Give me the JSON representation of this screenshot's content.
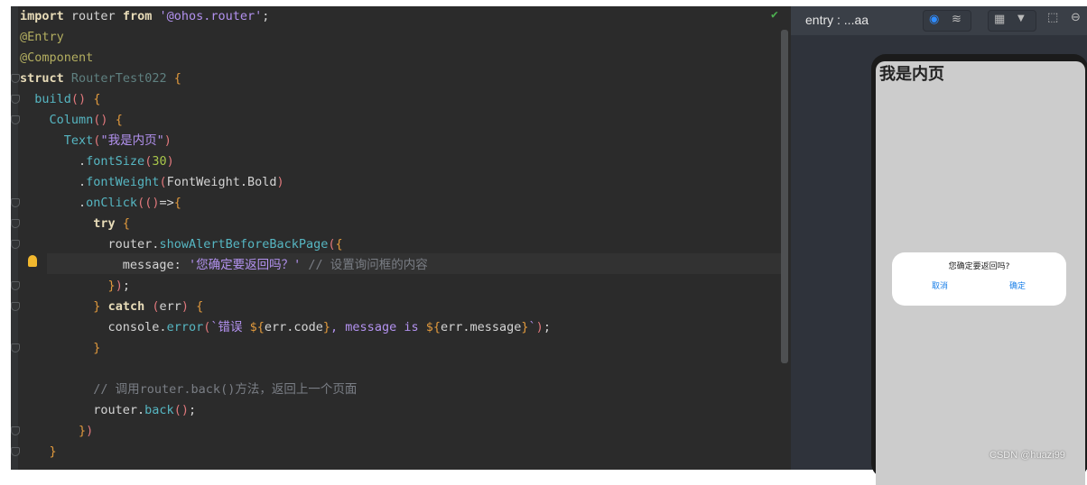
{
  "editor": {
    "lines": [
      [
        [
          "import",
          "kw"
        ],
        [
          " router ",
          "pl"
        ],
        [
          "from",
          "kw"
        ],
        [
          " ",
          "pl"
        ],
        [
          "'@ohos.router'",
          "str"
        ],
        [
          ";",
          "pl"
        ]
      ],
      [
        [
          "@Entry",
          "dec"
        ]
      ],
      [
        [
          "@Component",
          "dec"
        ]
      ],
      [
        [
          "struct",
          "kw"
        ],
        [
          " ",
          "pl"
        ],
        [
          "RouterTest022",
          "cls"
        ],
        [
          " ",
          "pl"
        ],
        [
          "{",
          "br"
        ]
      ],
      [
        [
          "  ",
          "pl"
        ],
        [
          "build",
          "fn"
        ],
        [
          "()",
          "par"
        ],
        [
          " ",
          "pl"
        ],
        [
          "{",
          "br"
        ]
      ],
      [
        [
          "    ",
          "pl"
        ],
        [
          "Column",
          "fn"
        ],
        [
          "()",
          "par"
        ],
        [
          " ",
          "pl"
        ],
        [
          "{",
          "br"
        ]
      ],
      [
        [
          "      ",
          "pl"
        ],
        [
          "Text",
          "fn"
        ],
        [
          "(",
          "par"
        ],
        [
          "\"我是内页\"",
          "str"
        ],
        [
          ")",
          "par"
        ]
      ],
      [
        [
          "        .",
          "pl"
        ],
        [
          "fontSize",
          "fn"
        ],
        [
          "(",
          "par"
        ],
        [
          "30",
          "num"
        ],
        [
          ")",
          "par"
        ]
      ],
      [
        [
          "        .",
          "pl"
        ],
        [
          "fontWeight",
          "fn"
        ],
        [
          "(",
          "par"
        ],
        [
          "FontWeight.Bold",
          "pl"
        ],
        [
          ")",
          "par"
        ]
      ],
      [
        [
          "        .",
          "pl"
        ],
        [
          "onClick",
          "fn"
        ],
        [
          "(()",
          "par"
        ],
        [
          "=>",
          "pl"
        ],
        [
          "{",
          "br"
        ]
      ],
      [
        [
          "          ",
          "pl"
        ],
        [
          "try",
          "kw"
        ],
        [
          " ",
          "pl"
        ],
        [
          "{",
          "br"
        ]
      ],
      [
        [
          "            router.",
          "pl"
        ],
        [
          "showAlertBeforeBackPage",
          "fn"
        ],
        [
          "(",
          "par"
        ],
        [
          "{",
          "br"
        ]
      ],
      [
        [
          "              message: ",
          "pl"
        ],
        [
          "'您确定要返回吗？'",
          "str"
        ],
        [
          " // 设置询问框的内容",
          "cm"
        ]
      ],
      [
        [
          "            ",
          "pl"
        ],
        [
          "}",
          "br"
        ],
        [
          ")",
          "par"
        ],
        [
          ";",
          "pl"
        ]
      ],
      [
        [
          "          ",
          "pl"
        ],
        [
          "}",
          "br"
        ],
        [
          " ",
          "pl"
        ],
        [
          "catch",
          "kw"
        ],
        [
          " ",
          "pl"
        ],
        [
          "(",
          "par"
        ],
        [
          "err",
          "pl"
        ],
        [
          ")",
          "par"
        ],
        [
          " ",
          "pl"
        ],
        [
          "{",
          "br"
        ]
      ],
      [
        [
          "            console.",
          "pl"
        ],
        [
          "error",
          "fn"
        ],
        [
          "(",
          "par"
        ],
        [
          "`错误 ",
          "str"
        ],
        [
          "${",
          "br"
        ],
        [
          "err.code",
          "pl"
        ],
        [
          "}",
          "br"
        ],
        [
          ", message is ",
          "str"
        ],
        [
          "${",
          "br"
        ],
        [
          "err.message",
          "pl"
        ],
        [
          "}",
          "br"
        ],
        [
          "`",
          "str"
        ],
        [
          ")",
          "par"
        ],
        [
          ";",
          "pl"
        ]
      ],
      [
        [
          "          ",
          "pl"
        ],
        [
          "}",
          "br"
        ]
      ],
      [
        [
          "",
          "pl"
        ]
      ],
      [
        [
          "          // 调用router.back()方法，返回上一个页面",
          "cm"
        ]
      ],
      [
        [
          "          router.",
          "pl"
        ],
        [
          "back",
          "fn"
        ],
        [
          "()",
          "par"
        ],
        [
          ";",
          "pl"
        ]
      ],
      [
        [
          "        ",
          "pl"
        ],
        [
          "}",
          "br"
        ],
        [
          ")",
          "par"
        ]
      ],
      [
        [
          "    ",
          "pl"
        ],
        [
          "}",
          "br"
        ]
      ]
    ]
  },
  "preview": {
    "entry_label": "entry : ...aa",
    "page_title": "我是内页",
    "dialog": {
      "message": "您确定要返回吗?",
      "cancel": "取消",
      "confirm": "确定"
    },
    "watermark": "CSDN @huazi99",
    "accent": "#1a7fe8"
  }
}
